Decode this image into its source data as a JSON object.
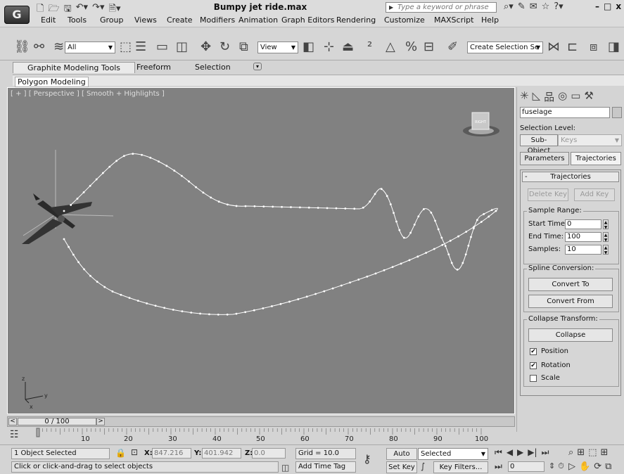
{
  "app": {
    "logo": "G",
    "title": "Bumpy jet ride.max",
    "search_placeholder": "Type a keyword or phrase",
    "window_controls": [
      "–",
      "□",
      "x"
    ]
  },
  "menu": [
    "Edit",
    "Tools",
    "Group",
    "Views",
    "Create",
    "Modifiers",
    "Animation",
    "Graph Editors",
    "Rendering",
    "Customize",
    "MAXScript",
    "Help"
  ],
  "toolbar": {
    "filter": "All",
    "ref_coord": "View",
    "named_sel": "Create Selection Se"
  },
  "ribbon": {
    "tabs": [
      "Graphite Modeling Tools",
      "Freeform",
      "Selection"
    ],
    "panel_label": "Polygon Modeling"
  },
  "viewport": {
    "label": "[ + ] [ Perspective ] [ Smooth + Highlights ]",
    "viewcube_face": "RIGHT",
    "axis_labels": [
      "z",
      "y",
      "x"
    ]
  },
  "command_panel": {
    "object_name": "fuselage",
    "selection_level_label": "Selection Level:",
    "subobject_button": "Sub-Object",
    "subobject_value": "Keys",
    "tabs": [
      "Parameters",
      "Trajectories"
    ],
    "rollout_title": "Trajectories",
    "delete_key": "Delete Key",
    "add_key": "Add Key",
    "sample_range": {
      "title": "Sample Range:",
      "start_label": "Start Time:",
      "start_value": "0",
      "end_label": "End Time:",
      "end_value": "100",
      "samples_label": "Samples:",
      "samples_value": "10"
    },
    "spline_conversion": {
      "title": "Spline Conversion:",
      "convert_to": "Convert To",
      "convert_from": "Convert From"
    },
    "collapse_transform": {
      "title": "Collapse Transform:",
      "collapse": "Collapse",
      "position": "Position",
      "rotation": "Rotation",
      "scale": "Scale",
      "position_checked": true,
      "rotation_checked": true,
      "scale_checked": false
    }
  },
  "timeline": {
    "frame_display": "0 / 100",
    "ticks": [
      "10",
      "20",
      "30",
      "40",
      "50",
      "60",
      "70",
      "80",
      "90",
      "100"
    ]
  },
  "status": {
    "selection": "1 Object Selected",
    "prompt": "Click or click-and-drag to select objects",
    "x_label": "X:",
    "x": "847.216",
    "y_label": "Y:",
    "y": "401.942",
    "z_label": "Z:",
    "z": "0.0",
    "grid": "Grid = 10.0",
    "add_time_tag": "Add Time Tag",
    "auto_key": "Auto Key",
    "set_key": "Set Key",
    "key_mode": "Selected",
    "key_filters": "Key Filters...",
    "current_frame": "0"
  }
}
